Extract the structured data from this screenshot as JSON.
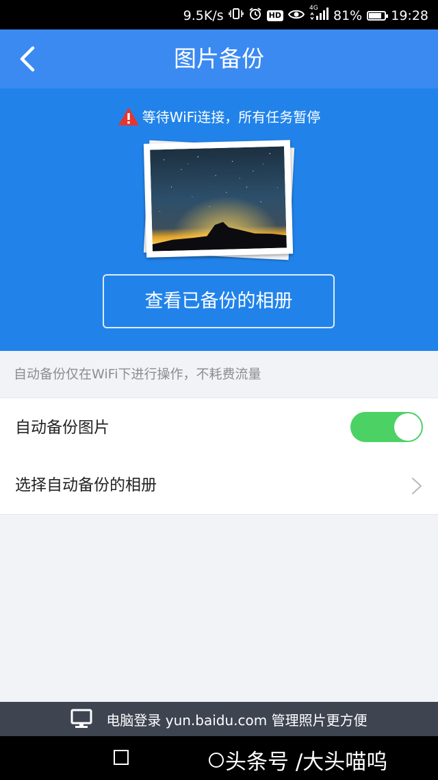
{
  "status_bar": {
    "net_speed": "9.5K/s",
    "hd_label": "HD",
    "network_label": "4G",
    "battery_percent_text": "81%",
    "battery_level": 0.81,
    "time": "19:28"
  },
  "app_bar": {
    "title": "图片备份",
    "back_icon": "chevron-left-icon"
  },
  "hero": {
    "warning_text": "等待WiFi连接，所有任务暂停",
    "warning_icon": "warning-triangle-icon",
    "view_button_label": "查看已备份的相册"
  },
  "settings": {
    "info_text": "自动备份仅在WiFi下进行操作，不耗费流量",
    "auto_backup_label": "自动备份图片",
    "auto_backup_enabled": true,
    "select_album_label": "选择自动备份的相册"
  },
  "banner": {
    "text": "电脑登录 yun.baidu.com 管理照片更方便",
    "icon": "monitor-icon"
  },
  "watermark": {
    "text": "头条号 /大头喵呜"
  },
  "colors": {
    "app_bar": "#3b8af2",
    "hero": "#2183ea",
    "toggle_on": "#4cd164",
    "banner": "#3f4451",
    "warning_red": "#e8342c"
  }
}
